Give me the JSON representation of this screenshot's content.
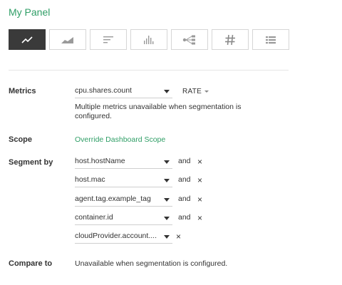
{
  "panel": {
    "title": "My Panel"
  },
  "chart_types": [
    {
      "icon": "line-chart-icon",
      "selected": true
    },
    {
      "icon": "area-chart-icon",
      "selected": false
    },
    {
      "icon": "horizontal-bar-icon",
      "selected": false
    },
    {
      "icon": "histogram-icon",
      "selected": false
    },
    {
      "icon": "topology-icon",
      "selected": false
    },
    {
      "icon": "number-icon",
      "selected": false
    },
    {
      "icon": "table-icon",
      "selected": false
    }
  ],
  "metrics": {
    "label": "Metrics",
    "value": "cpu.shares.count",
    "aggregation": "RATE",
    "note": "Multiple metrics unavailable when segmentation is configured."
  },
  "scope": {
    "label": "Scope",
    "link": "Override Dashboard Scope"
  },
  "segment_by": {
    "label": "Segment by",
    "items": [
      {
        "value": "host.hostName",
        "connector": "and"
      },
      {
        "value": "host.mac",
        "connector": "and"
      },
      {
        "value": "agent.tag.example_tag",
        "connector": "and"
      },
      {
        "value": "container.id",
        "connector": "and"
      },
      {
        "value": "cloudProvider.account....",
        "connector": ""
      }
    ],
    "remove_symbol": "×"
  },
  "compare_to": {
    "label": "Compare to",
    "text": "Unavailable when segmentation is configured."
  },
  "colors": {
    "accent": "#2f9e66",
    "active_button": "#3a3a3a"
  }
}
